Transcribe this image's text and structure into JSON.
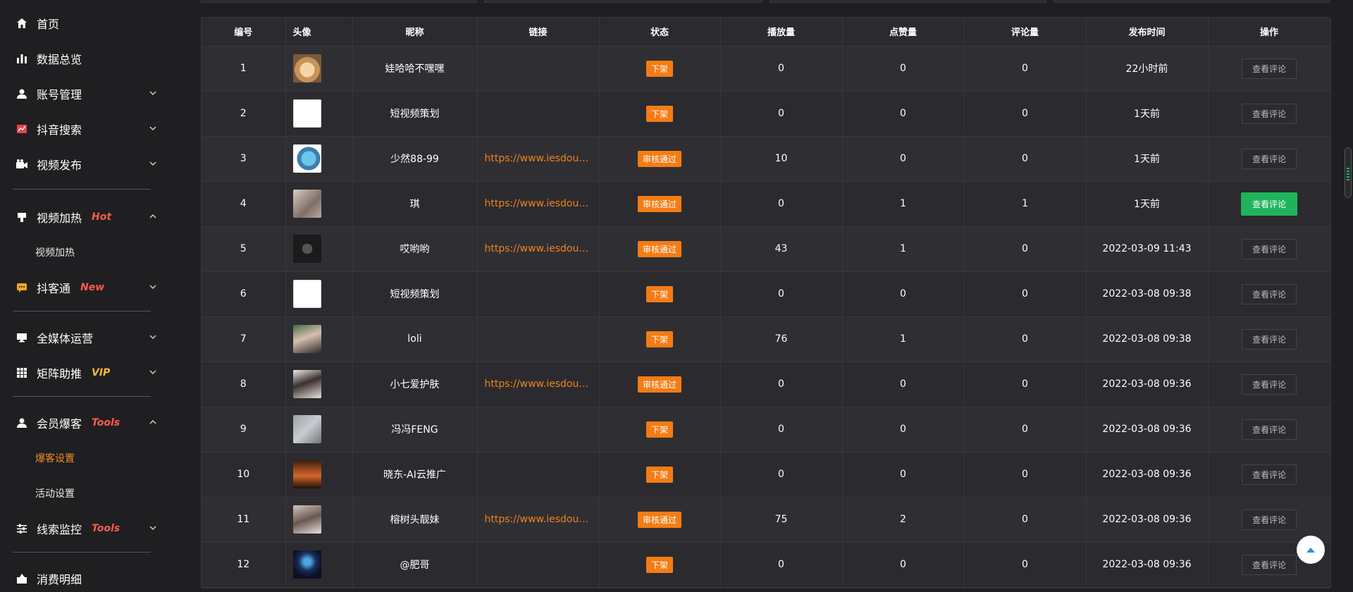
{
  "sidebar": {
    "items": [
      {
        "label": "首页"
      },
      {
        "label": "数据总览"
      },
      {
        "label": "账号管理"
      },
      {
        "label": "抖音搜索"
      },
      {
        "label": "视频发布"
      },
      {
        "label": "视频加热",
        "tag": "Hot",
        "tag_color": "#ff5a4a",
        "sub": [
          "视频加热"
        ]
      },
      {
        "label": "抖客通",
        "tag": "New",
        "tag_color": "#ff5a4a"
      },
      {
        "label": "全媒体运营"
      },
      {
        "label": "矩阵助推",
        "tag": "VIP",
        "tag_color": "#f5b83a"
      },
      {
        "label": "会员爆客",
        "tag": "Tools",
        "tag_color": "#ff5a4a",
        "sub": [
          "爆客设置",
          "活动设置"
        ]
      },
      {
        "label": "线索监控",
        "tag": "Tools",
        "tag_color": "#ff5a4a"
      },
      {
        "label": "消费明细"
      }
    ]
  },
  "table": {
    "headers": [
      "编号",
      "头像",
      "昵称",
      "链接",
      "状态",
      "播放量",
      "点赞量",
      "评论量",
      "发布时间",
      "操作"
    ],
    "rows": [
      {
        "id": "1",
        "avatar": "dog",
        "name": "娃哈哈不嘿嘿",
        "link": "",
        "status": "下架",
        "plays": "0",
        "likes": "0",
        "comments": "0",
        "time": "22小时前",
        "action": "查看评论"
      },
      {
        "id": "2",
        "avatar": "logo",
        "name": "短视频策划",
        "link": "",
        "status": "下架",
        "plays": "0",
        "likes": "0",
        "comments": "0",
        "time": "1天前",
        "action": "查看评论"
      },
      {
        "id": "3",
        "avatar": "shark",
        "name": "少然88-99",
        "link": "https://www.iesdouyin.com/",
        "status": "审核通过",
        "plays": "10",
        "likes": "0",
        "comments": "0",
        "time": "1天前",
        "action": "查看评论"
      },
      {
        "id": "4",
        "avatar": "girl",
        "name": "琪",
        "link": "https://www.iesdouyin.com/",
        "status": "审核通过",
        "plays": "0",
        "likes": "1",
        "comments": "1",
        "time": "1天前",
        "action": "查看评论",
        "highlight": true
      },
      {
        "id": "5",
        "avatar": "dark",
        "name": "哎哟哟",
        "link": "https://www.iesdouyin.com/",
        "status": "审核通过",
        "plays": "43",
        "likes": "1",
        "comments": "0",
        "time": "2022-03-09 11:43",
        "action": "查看评论"
      },
      {
        "id": "6",
        "avatar": "logo",
        "name": "短视频策划",
        "link": "",
        "status": "下架",
        "plays": "0",
        "likes": "0",
        "comments": "0",
        "time": "2022-03-08 09:38",
        "action": "查看评论"
      },
      {
        "id": "7",
        "avatar": "girl2",
        "name": "loli",
        "link": "",
        "status": "下架",
        "plays": "76",
        "likes": "1",
        "comments": "0",
        "time": "2022-03-08 09:38",
        "action": "查看评论"
      },
      {
        "id": "8",
        "avatar": "girl3",
        "name": "小七爱护肤",
        "link": "https://www.iesdouyin.com/",
        "status": "审核通过",
        "plays": "0",
        "likes": "0",
        "comments": "0",
        "time": "2022-03-08 09:36",
        "action": "查看评论"
      },
      {
        "id": "9",
        "avatar": "cat",
        "name": "冯冯FENG",
        "link": "",
        "status": "下架",
        "plays": "0",
        "likes": "0",
        "comments": "0",
        "time": "2022-03-08 09:36",
        "action": "查看评论"
      },
      {
        "id": "10",
        "avatar": "sunset",
        "name": "晓东-AI云推广",
        "link": "",
        "status": "下架",
        "plays": "0",
        "likes": "0",
        "comments": "0",
        "time": "2022-03-08 09:36",
        "action": "查看评论"
      },
      {
        "id": "11",
        "avatar": "girl4",
        "name": "榕树头靓妹",
        "link": "https://www.iesdouyin.com/",
        "status": "审核通过",
        "plays": "75",
        "likes": "2",
        "comments": "0",
        "time": "2022-03-08 09:36",
        "action": "查看评论"
      },
      {
        "id": "12",
        "avatar": "night",
        "name": "@肥哥",
        "link": "",
        "status": "下架",
        "plays": "0",
        "likes": "0",
        "comments": "0",
        "time": "2022-03-08 09:36",
        "action": "查看评论"
      }
    ]
  },
  "colors": {
    "accent": "#f47c14",
    "link": "#f0801e",
    "active_button": "#1fb45c",
    "background": "#1f1f22"
  }
}
